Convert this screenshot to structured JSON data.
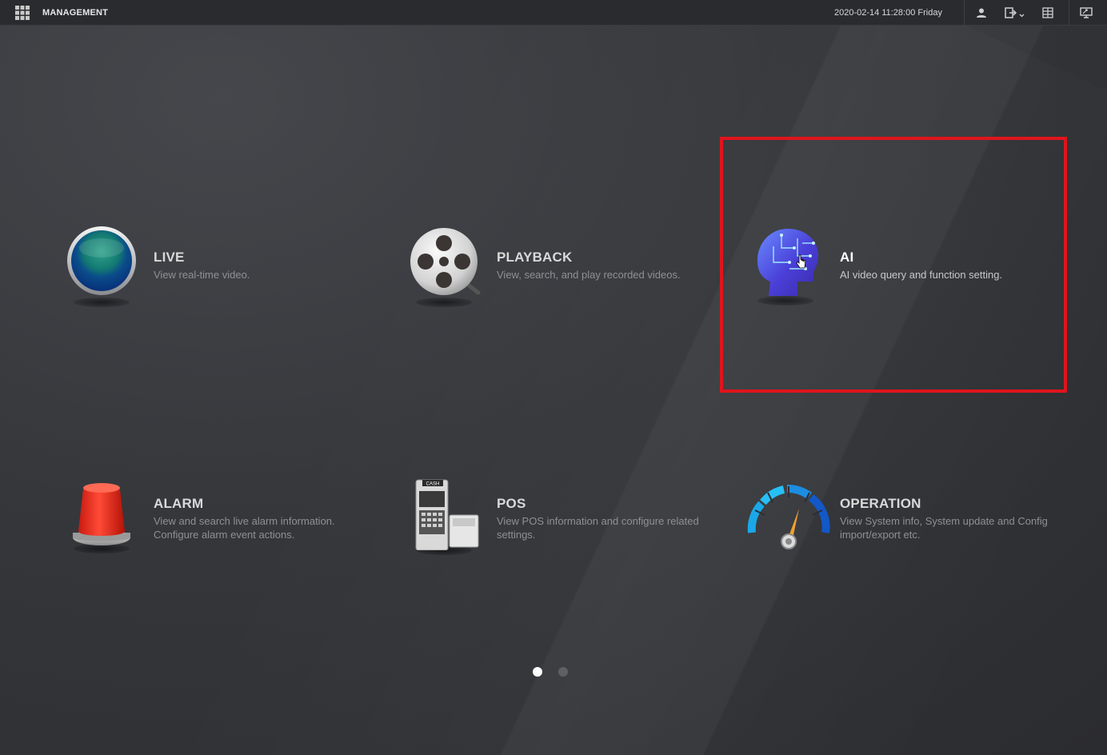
{
  "topbar": {
    "title": "MANAGEMENT",
    "datetime": "2020-02-14 11:28:00 Friday",
    "icons": [
      "menu-grid-icon",
      "user-icon",
      "logout-icon",
      "split-screen-icon",
      "monitor-icon"
    ]
  },
  "tiles": [
    {
      "id": "live",
      "title": "LIVE",
      "desc": [
        "View real-time video."
      ],
      "icon": "live-globe-icon"
    },
    {
      "id": "playback",
      "title": "PLAYBACK",
      "desc": [
        "View, search, and play recorded videos."
      ],
      "icon": "film-reel-icon"
    },
    {
      "id": "ai",
      "title": "AI",
      "desc": [
        "AI video query and function setting."
      ],
      "icon": "ai-head-icon"
    },
    {
      "id": "alarm",
      "title": "ALARM",
      "desc": [
        "View and search live alarm information.",
        "Configure alarm event actions."
      ],
      "icon": "alarm-siren-icon"
    },
    {
      "id": "pos",
      "title": "POS",
      "desc": [
        "View POS information and configure related",
        "settings."
      ],
      "icon": "cash-register-icon",
      "icon_label": "CASH"
    },
    {
      "id": "operation",
      "title": "OPERATION",
      "desc": [
        "View System info, System update and Config",
        "import/export etc."
      ],
      "icon": "gauge-icon"
    }
  ],
  "pagination": {
    "pages": 2,
    "current": 1
  },
  "colors": {
    "highlight": "#e0141c",
    "background": "#2e3034"
  }
}
